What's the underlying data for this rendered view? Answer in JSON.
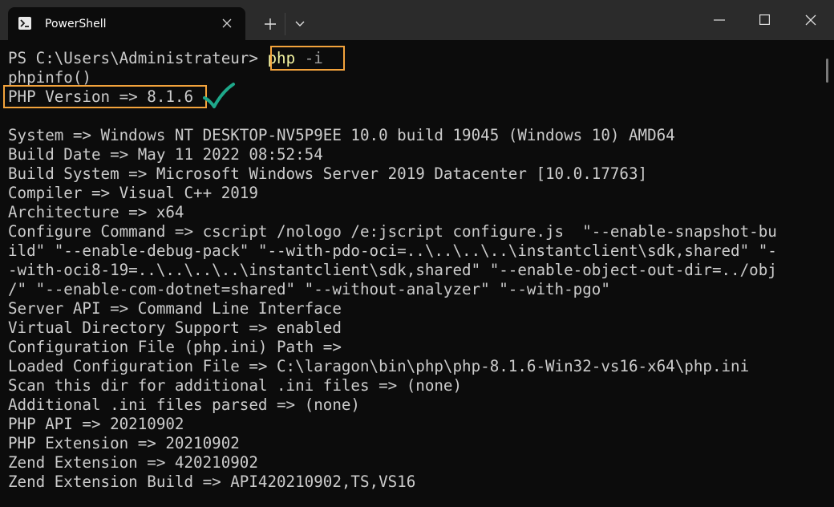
{
  "window": {
    "tab_title": "PowerShell"
  },
  "prompt": {
    "path": "PS C:\\Users\\Administrateur>",
    "command": "php",
    "argument": "-i"
  },
  "output": [
    "phpinfo()",
    "PHP Version => 8.1.6",
    "",
    "System => Windows NT DESKTOP-NV5P9EE 10.0 build 19045 (Windows 10) AMD64",
    "Build Date => May 11 2022 08:52:54",
    "Build System => Microsoft Windows Server 2019 Datacenter [10.0.17763]",
    "Compiler => Visual C++ 2019",
    "Architecture => x64",
    "Configure Command => cscript /nologo /e:jscript configure.js  \"--enable-snapshot-bu",
    "ild\" \"--enable-debug-pack\" \"--with-pdo-oci=..\\..\\..\\..\\instantclient\\sdk,shared\" \"-",
    "-with-oci8-19=..\\..\\..\\..\\instantclient\\sdk,shared\" \"--enable-object-out-dir=../obj",
    "/\" \"--enable-com-dotnet=shared\" \"--without-analyzer\" \"--with-pgo\"",
    "Server API => Command Line Interface",
    "Virtual Directory Support => enabled",
    "Configuration File (php.ini) Path =>",
    "Loaded Configuration File => C:\\laragon\\bin\\php\\php-8.1.6-Win32-vs16-x64\\php.ini",
    "Scan this dir for additional .ini files => (none)",
    "Additional .ini files parsed => (none)",
    "PHP API => 20210902",
    "PHP Extension => 20210902",
    "Zend Extension => 420210902",
    "Zend Extension Build => API420210902,TS,VS16"
  ],
  "colors": {
    "highlight": "#f3a33c",
    "check": "#1ea88a",
    "background": "#0c0c0c",
    "text": "#cccccc"
  },
  "icons": [
    "powershell-icon",
    "close-icon",
    "plus-icon",
    "chevron-down-icon",
    "minimize-icon",
    "maximize-icon",
    "window-close-icon",
    "check-icon"
  ]
}
